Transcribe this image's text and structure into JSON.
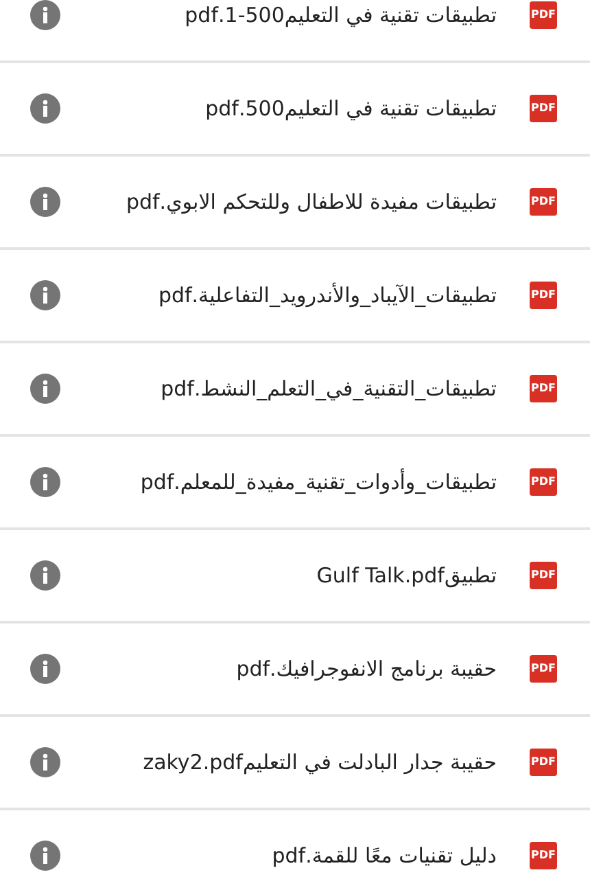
{
  "files": [
    {
      "name": "تطبيقات تقنية في التعليم500-1.pdf",
      "badge": "PDF"
    },
    {
      "name": "تطبيقات تقنية في التعليم500.pdf",
      "badge": "PDF"
    },
    {
      "name": "تطبيقات مفيدة للاطفال وللتحكم الابوي.pdf",
      "badge": "PDF"
    },
    {
      "name": "تطبيقات_الآيباد_والأندرويد_التفاعلية.pdf",
      "badge": "PDF"
    },
    {
      "name": "تطبيقات_التقنية_في_التعلم_النشط.pdf",
      "badge": "PDF"
    },
    {
      "name": "تطبيقات_وأدوات_تقنية_مفيدة_للمعلم.pdf",
      "badge": "PDF"
    },
    {
      "name": "تطبيقGulf Talk.pdf",
      "badge": "PDF"
    },
    {
      "name": "حقيبة برنامج الانفوجرافيك.pdf",
      "badge": "PDF"
    },
    {
      "name": "حقيبة جدار البادلت في التعليمzaky2.pdf",
      "badge": "PDF"
    },
    {
      "name": "دليل تقنيات معًا للقمة.pdf",
      "badge": "PDF"
    }
  ]
}
